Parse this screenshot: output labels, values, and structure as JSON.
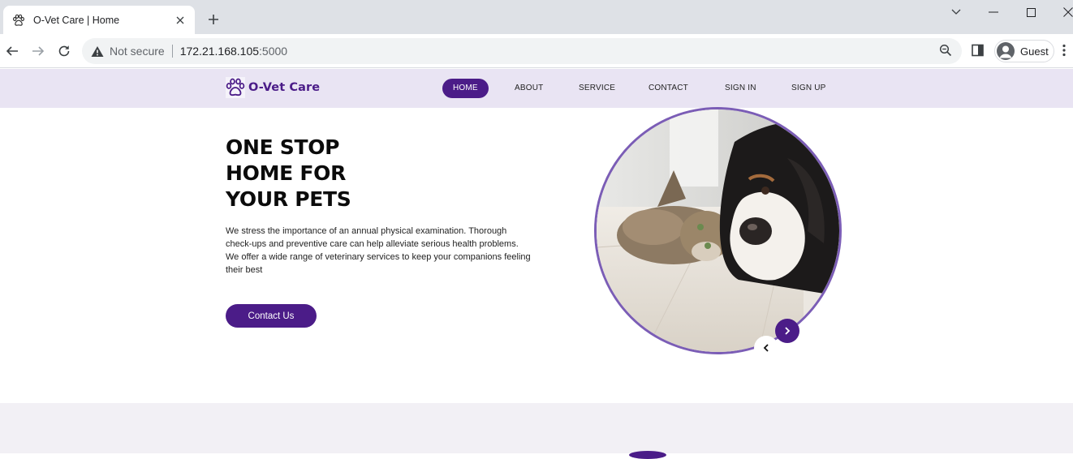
{
  "browser": {
    "tab_title": "O-Vet Care | Home",
    "security_label": "Not secure",
    "url_host": "172.21.168.105",
    "url_port": ":5000",
    "profile_label": "Guest"
  },
  "site": {
    "brand_name": "O-Vet Care",
    "nav": [
      {
        "label": "HOME",
        "active": true
      },
      {
        "label": "ABOUT",
        "active": false
      },
      {
        "label": "SERVICE",
        "active": false
      },
      {
        "label": "CONTACT",
        "active": false
      },
      {
        "label": "SIGN IN",
        "active": false
      },
      {
        "label": "SIGN UP",
        "active": false
      }
    ],
    "hero": {
      "title_lines": [
        "ONE STOP",
        "HOME FOR",
        "YOUR PETS"
      ],
      "description": "We stress the importance of an annual physical examination. Thorough check-ups and preventive care can help alleviate serious health problems. We offer a wide range of veterinary services to keep your companions feeling their best",
      "cta_label": "Contact Us"
    },
    "colors": {
      "brand": "#4b1c88",
      "nav_background": "#e9e4f3",
      "ring": "#7b5db6"
    }
  }
}
